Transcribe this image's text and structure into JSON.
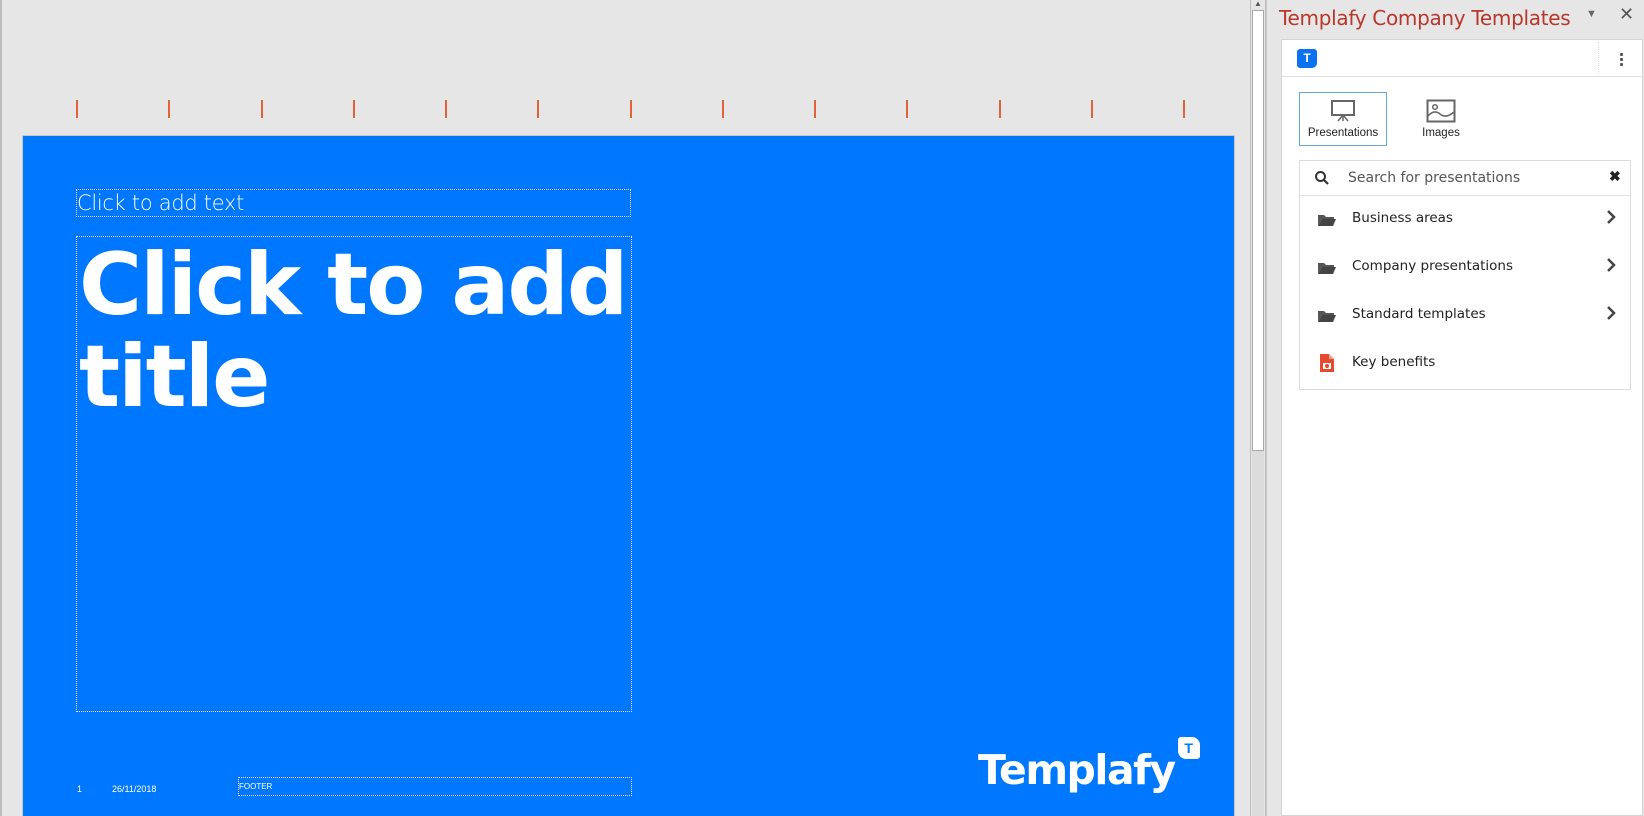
{
  "slide": {
    "subtitle_placeholder": "Click to add text",
    "title_placeholder": "Click to add title",
    "slide_number": "1",
    "date": "26/11/2018",
    "footer": "FOOTER",
    "logo_text": "Templafy",
    "logo_badge": "T",
    "background_color": "#0077ff"
  },
  "guides": {
    "count": 13,
    "color": "#e0633a"
  },
  "pane": {
    "title": "Templafy Company Templates",
    "dropdown_icon": "caret-down-icon",
    "close_icon": "close-icon",
    "app_icon_letter": "T",
    "more_icon": "kebab-menu-icon",
    "tabs": [
      {
        "label": "Presentations",
        "icon": "presentation-board-icon",
        "active": true
      },
      {
        "label": "Images",
        "icon": "image-icon",
        "active": false
      }
    ],
    "search": {
      "placeholder": "Search for presentations",
      "value": ""
    },
    "items": [
      {
        "label": "Business areas",
        "icon": "folder-open-icon",
        "has_children": true
      },
      {
        "label": "Company presentations",
        "icon": "folder-open-icon",
        "has_children": true
      },
      {
        "label": "Standard templates",
        "icon": "folder-open-icon",
        "has_children": true
      },
      {
        "label": "Key benefits",
        "icon": "powerpoint-file-icon",
        "has_children": false
      }
    ]
  }
}
